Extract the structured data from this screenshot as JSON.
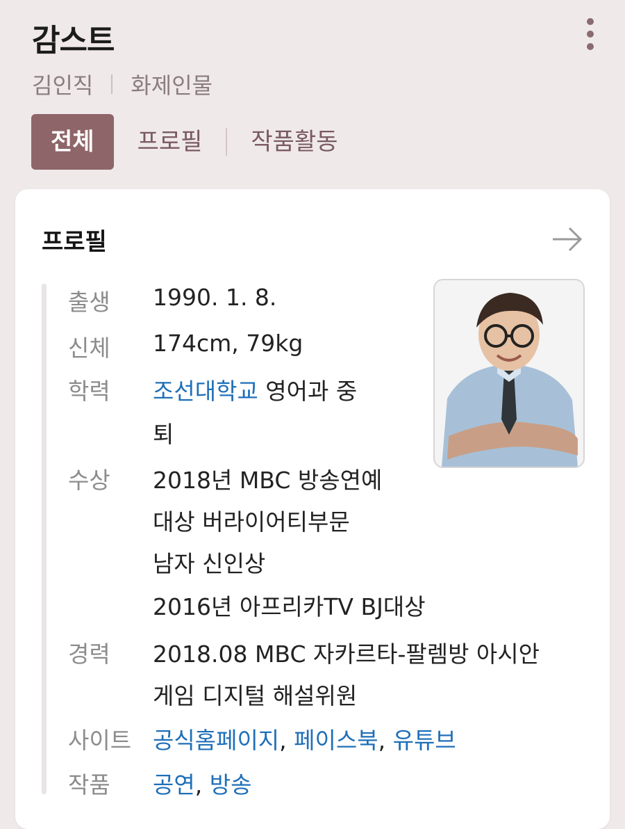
{
  "header": {
    "title": "감스트",
    "sub": [
      "김인직",
      "화제인물"
    ]
  },
  "tabs": [
    "전체",
    "프로필",
    "작품활동"
  ],
  "profile": {
    "heading": "프로필",
    "birth": {
      "label": "출생",
      "value": "1990. 1. 8."
    },
    "body": {
      "label": "신체",
      "value": "174cm, 79kg"
    },
    "education": {
      "label": "학력",
      "link": "조선대학교",
      "rest1": " 영어과 중",
      "rest2": "퇴"
    },
    "awards": {
      "label": "수상",
      "lines": [
        "2018년 MBC 방송연예",
        "대상 버라이어티부문",
        "남자 신인상",
        "2016년 아프리카TV BJ대상"
      ]
    },
    "career": {
      "label": "경력",
      "lines": [
        "2018.08 MBC 자카르타-팔렘방 아시안",
        "게임 디지털 해설위원"
      ]
    },
    "site": {
      "label": "사이트",
      "links": [
        "공식홈페이지",
        "페이스북",
        "유튜브"
      ],
      "sep": ","
    },
    "works": {
      "label": "작품",
      "links": [
        "공연",
        "방송"
      ]
    }
  },
  "colors": {
    "accent": "#8e6568",
    "link": "#1f6fb8",
    "background": "#efe9ea"
  },
  "icons": {
    "more": "more-vertical-icon",
    "arrow": "arrow-right-icon"
  }
}
